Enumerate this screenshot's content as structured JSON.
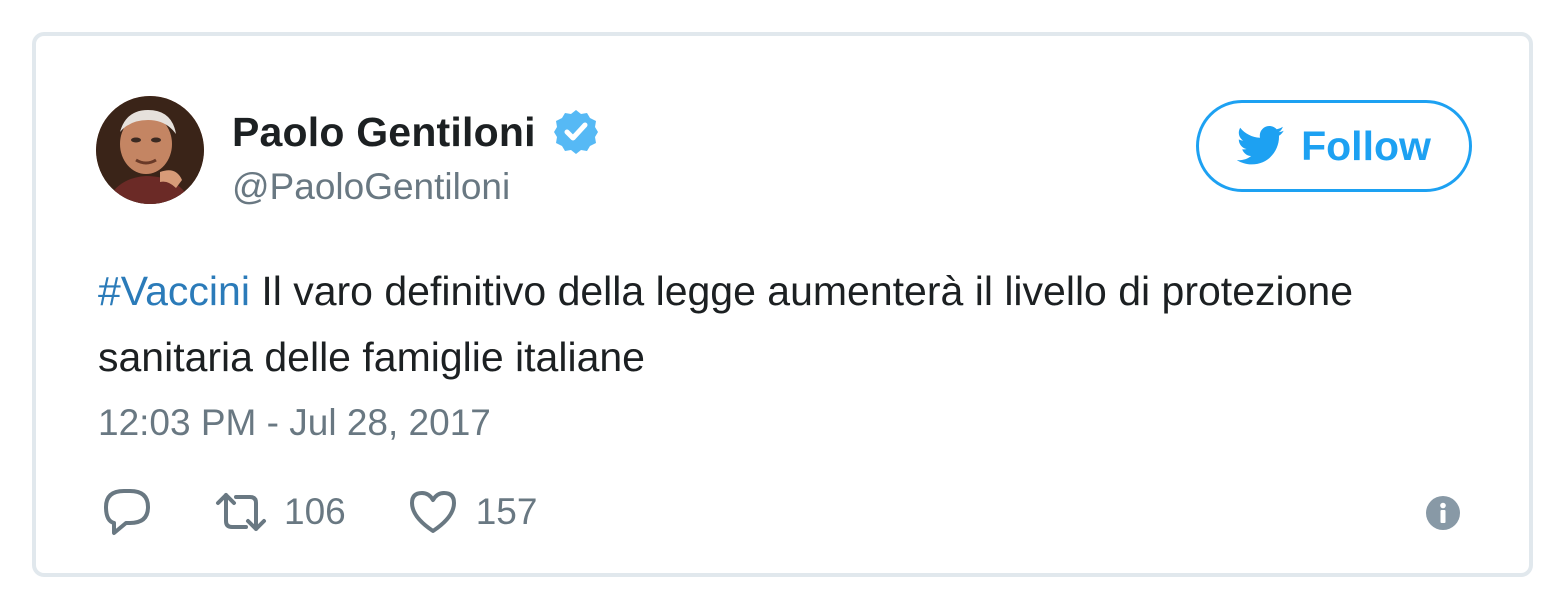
{
  "author": {
    "name": "Paolo Gentiloni",
    "handle": "@PaoloGentiloni",
    "verified": true
  },
  "follow_button": {
    "label": "Follow"
  },
  "tweet": {
    "hashtag": "#Vaccini",
    "body": " Il varo definitivo della legge aumenterà il livello di protezione sanitaria delle famiglie italiane",
    "timestamp": "12:03 PM - Jul 28, 2017"
  },
  "actions": {
    "retweets": "106",
    "likes": "157"
  },
  "icons": {
    "reply": "reply-icon",
    "retweet": "retweet-icon",
    "like": "heart-icon",
    "info": "info-icon",
    "follow": "twitter-bird-icon",
    "verified": "verified-badge-icon"
  },
  "colors": {
    "accent": "#1da1f2",
    "hashtag": "#2b7bb9",
    "secondary_text": "#697882",
    "border": "#e1e8ed"
  }
}
